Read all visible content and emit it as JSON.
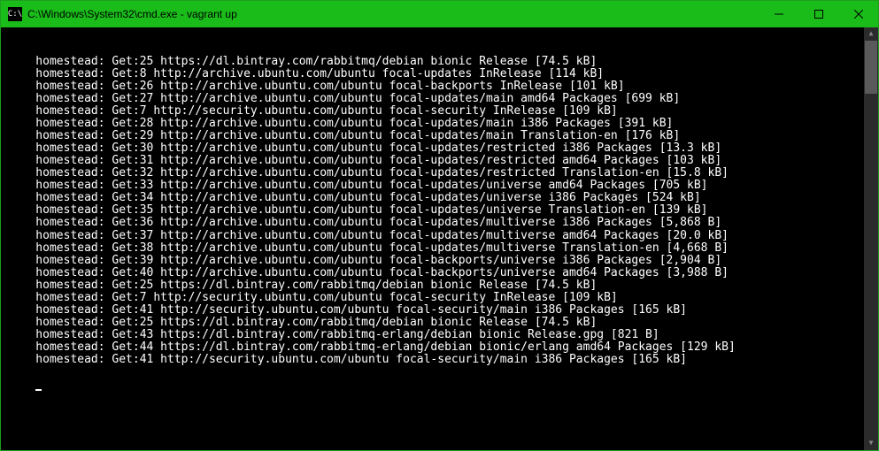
{
  "window": {
    "title": "C:\\Windows\\System32\\cmd.exe - vagrant  up",
    "icon_glyph": "C:\\"
  },
  "terminal": {
    "prefix": "    homestead: ",
    "lines": [
      "Get:25 https://dl.bintray.com/rabbitmq/debian bionic Release [74.5 kB]",
      "Get:8 http://archive.ubuntu.com/ubuntu focal-updates InRelease [114 kB]",
      "Get:26 http://archive.ubuntu.com/ubuntu focal-backports InRelease [101 kB]",
      "Get:27 http://archive.ubuntu.com/ubuntu focal-updates/main amd64 Packages [699 kB]",
      "Get:7 http://security.ubuntu.com/ubuntu focal-security InRelease [109 kB]",
      "Get:28 http://archive.ubuntu.com/ubuntu focal-updates/main i386 Packages [391 kB]",
      "Get:29 http://archive.ubuntu.com/ubuntu focal-updates/main Translation-en [176 kB]",
      "Get:30 http://archive.ubuntu.com/ubuntu focal-updates/restricted i386 Packages [13.3 kB]",
      "Get:31 http://archive.ubuntu.com/ubuntu focal-updates/restricted amd64 Packages [103 kB]",
      "Get:32 http://archive.ubuntu.com/ubuntu focal-updates/restricted Translation-en [15.8 kB]",
      "Get:33 http://archive.ubuntu.com/ubuntu focal-updates/universe amd64 Packages [705 kB]",
      "Get:34 http://archive.ubuntu.com/ubuntu focal-updates/universe i386 Packages [524 kB]",
      "Get:35 http://archive.ubuntu.com/ubuntu focal-updates/universe Translation-en [139 kB]",
      "Get:36 http://archive.ubuntu.com/ubuntu focal-updates/multiverse i386 Packages [5,868 B]",
      "Get:37 http://archive.ubuntu.com/ubuntu focal-updates/multiverse amd64 Packages [20.0 kB]",
      "Get:38 http://archive.ubuntu.com/ubuntu focal-updates/multiverse Translation-en [4,668 B]",
      "Get:39 http://archive.ubuntu.com/ubuntu focal-backports/universe i386 Packages [2,904 B]",
      "Get:40 http://archive.ubuntu.com/ubuntu focal-backports/universe amd64 Packages [3,988 B]",
      "Get:25 https://dl.bintray.com/rabbitmq/debian bionic Release [74.5 kB]",
      "Get:7 http://security.ubuntu.com/ubuntu focal-security InRelease [109 kB]",
      "Get:41 http://security.ubuntu.com/ubuntu focal-security/main i386 Packages [165 kB]",
      "Get:25 https://dl.bintray.com/rabbitmq/debian bionic Release [74.5 kB]",
      "Get:43 https://dl.bintray.com/rabbitmq-erlang/debian bionic Release.gpg [821 B]",
      "Get:44 https://dl.bintray.com/rabbitmq-erlang/debian bionic/erlang amd64 Packages [129 kB]",
      "Get:41 http://security.ubuntu.com/ubuntu focal-security/main i386 Packages [165 kB]"
    ]
  }
}
